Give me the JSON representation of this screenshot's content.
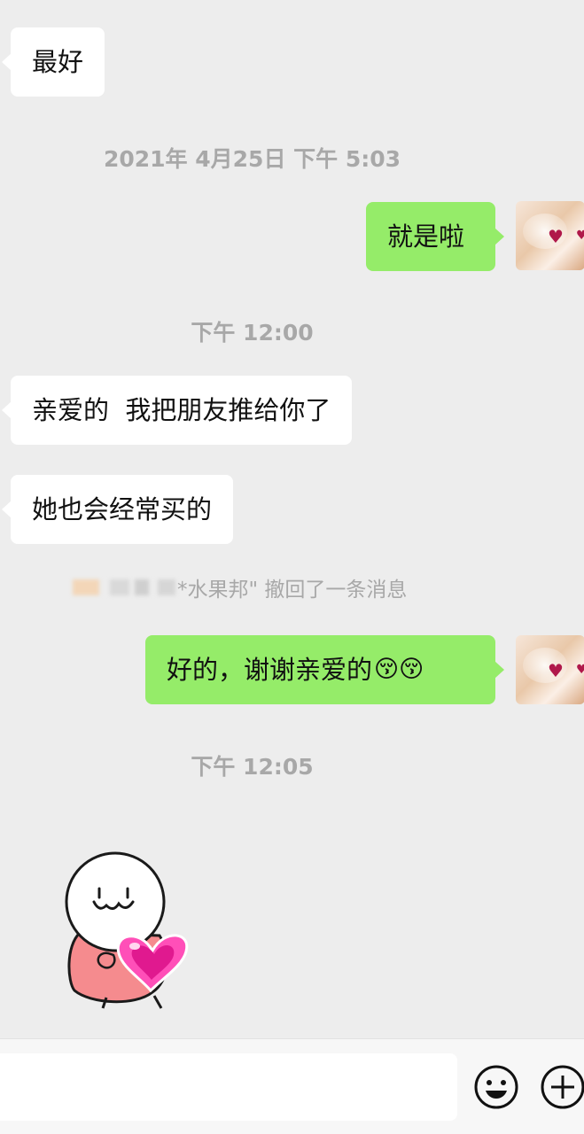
{
  "messages": {
    "m1": "最好",
    "t1": "2021年 4月25日 下午 5:03",
    "m2": "就是啦",
    "t2": "下午 12:00",
    "m3": "亲爱的  我把朋友推给你了",
    "m4": "她也会经常买的",
    "recall_text": "*水果邦\" 撤回了一条消息",
    "m5": "好的，谢谢亲爱的",
    "m5_emoji": "😚😚",
    "t3": "下午 12:05"
  },
  "colors": {
    "background": "#ededed",
    "incoming_bubble": "#ffffff",
    "outgoing_bubble": "#95ec69",
    "timestamp_text": "#a8a8a8"
  },
  "icons": {
    "emoji_button": "smiley-face-icon",
    "more_button": "plus-circle-icon"
  }
}
